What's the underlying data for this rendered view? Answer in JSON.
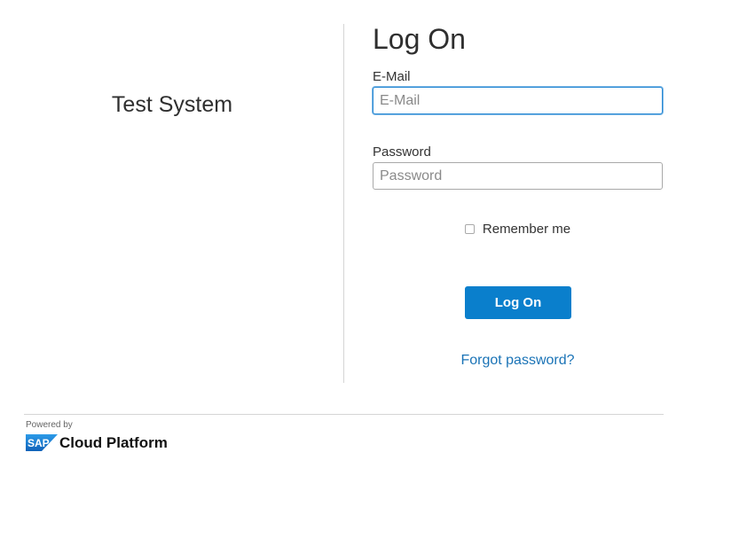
{
  "left": {
    "system_name": "Test System"
  },
  "form": {
    "title": "Log On",
    "email_label": "E-Mail",
    "email_placeholder": "E-Mail",
    "email_value": "",
    "password_label": "Password",
    "password_placeholder": "Password",
    "password_value": "",
    "remember_label": "Remember me",
    "remember_checked": false,
    "logon_button": "Log On",
    "forgot_link": "Forgot password?"
  },
  "footer": {
    "powered_by": "Powered by",
    "logo_text": "SAP",
    "brand_name": "Cloud Platform"
  },
  "colors": {
    "primary_button": "#0a7fcc",
    "link": "#1a73b6",
    "focus_border": "#2a8ad4",
    "sap_logo_blue": "#1a7fd4"
  },
  "icons": {
    "sap": "sap-logo-icon",
    "checkbox": "checkbox-icon"
  }
}
